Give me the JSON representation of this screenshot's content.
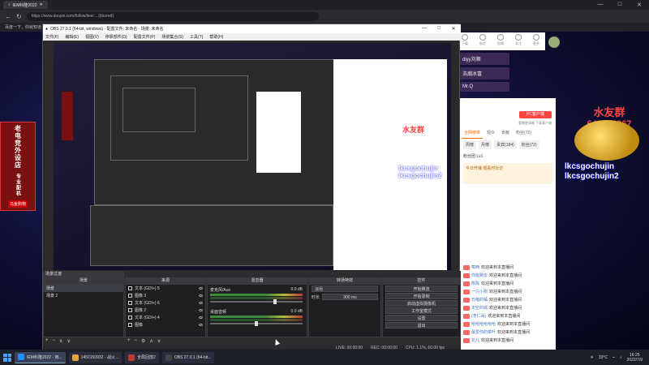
{
  "browser": {
    "tab_title": "IEM科隆2022",
    "url": "https://www.douyin.com/follow/live/... (blurred)",
    "bookmark_items": [
      "百度一下，你就知道",
      "京东",
      "淘宝"
    ],
    "window_controls": [
      "—",
      "□",
      "✕"
    ]
  },
  "left_banner": {
    "text": "老电竞外设店",
    "side": "专业配机",
    "bottom": "马鱼购物"
  },
  "douyin_right": {
    "top_icons": [
      "下载",
      "私信",
      "投稿",
      "关注",
      "更多"
    ],
    "rank_items": [
      "diyy刘顺",
      "浩瀚冰富",
      "Mr.Q"
    ],
    "overlay_name": "水友群",
    "overlay_number": "640496867",
    "overlay_id_1": "lkcsgochujin",
    "overlay_id_2": "lkcsgochujin2",
    "pc_button": "PC客户端",
    "pc_hint": "看播更清晰 下载客户端",
    "tabs": [
      "全网榜单",
      "观众",
      "贡献",
      "粉丝(72)"
    ],
    "subtabs": [
      "周榜",
      "月榜",
      "贵宾(184)",
      "粉丝(72)"
    ],
    "fans_label": "粉丝团  Lv1",
    "card_text": "今日开播 观看时长达",
    "chat": [
      {
        "name": "莓西",
        "msg": "欢迎来到本直播间"
      },
      {
        "name": "你能跑去",
        "msg": "欢迎来到本直播间"
      },
      {
        "name": "陈陈",
        "msg": "欢迎来到本直播间"
      },
      {
        "name": "一只小狗",
        "msg": "欢迎来到本直播间"
      },
      {
        "name": "石榴的橘",
        "msg": "欢迎来到本直播间"
      },
      {
        "name": "天空的城",
        "msg": "欢迎来到本直播间"
      },
      {
        "name": "(李仁哥)",
        "msg": "欢迎来到本直播间"
      },
      {
        "name": "哈哈哈哈哈哈",
        "msg": "欢迎来到本直播间"
      },
      {
        "name": "最爱你的菜叶",
        "msg": "欢迎来到本直播间"
      },
      {
        "name": "花儿",
        "msg": "欢迎来到本直播间"
      }
    ]
  },
  "obs": {
    "title": "OBS 27.0.1 (64-bit, windows) - 配置文件: 未命名 - 场景: 未命名",
    "menu": [
      "文件(F)",
      "编辑(E)",
      "视图(V)",
      "停靠部件(D)",
      "配置文件(P)",
      "场景集合(S)",
      "工具(T)",
      "帮助(H)"
    ],
    "scene_transition_head": "场景过渡",
    "docks": {
      "scenes_head": "场景",
      "sources_head": "来源",
      "mixer_head": "混音器",
      "transitions_head": "转场特效",
      "controls_head": "控件"
    },
    "scenes": [
      "场景",
      "场景 2"
    ],
    "sources": [
      "文本 (GDI+) 5",
      "图像 3",
      "文本 (GDI+) 6",
      "图像 2",
      "文本 (GDI+) 4",
      "图像"
    ],
    "mixer": [
      {
        "name": "麦克风/Aux",
        "db": "0.0 dB",
        "level": 0.7
      },
      {
        "name": "桌面音频",
        "db": "0.0 dB",
        "level": 0.5
      }
    ],
    "transition": {
      "type": "淡出",
      "duration_label": "时长",
      "duration": "300 ms"
    },
    "controls": [
      "开始推流",
      "开始录制",
      "启动虚拟摄像机",
      "工作室模式",
      "设置",
      "退出"
    ],
    "status": {
      "live": "LIVE: 00:00:00",
      "rec": "REC: 00:00:00",
      "cpu": "CPU: 1.1%, 60.00 fps"
    }
  },
  "taskbar": {
    "items": [
      {
        "label": "IEM科隆2022 - 用...",
        "color": "#1f8fff"
      },
      {
        "label": "1450150932 - 战火...",
        "color": "#e6a23c"
      },
      {
        "label": "全局回放2",
        "color": "#c0392b"
      },
      {
        "label": "OBS 27.0.1 (64-bit...",
        "color": "#444444"
      }
    ],
    "weather": "33°C",
    "time": "16:25",
    "date": "2022/7/9"
  }
}
